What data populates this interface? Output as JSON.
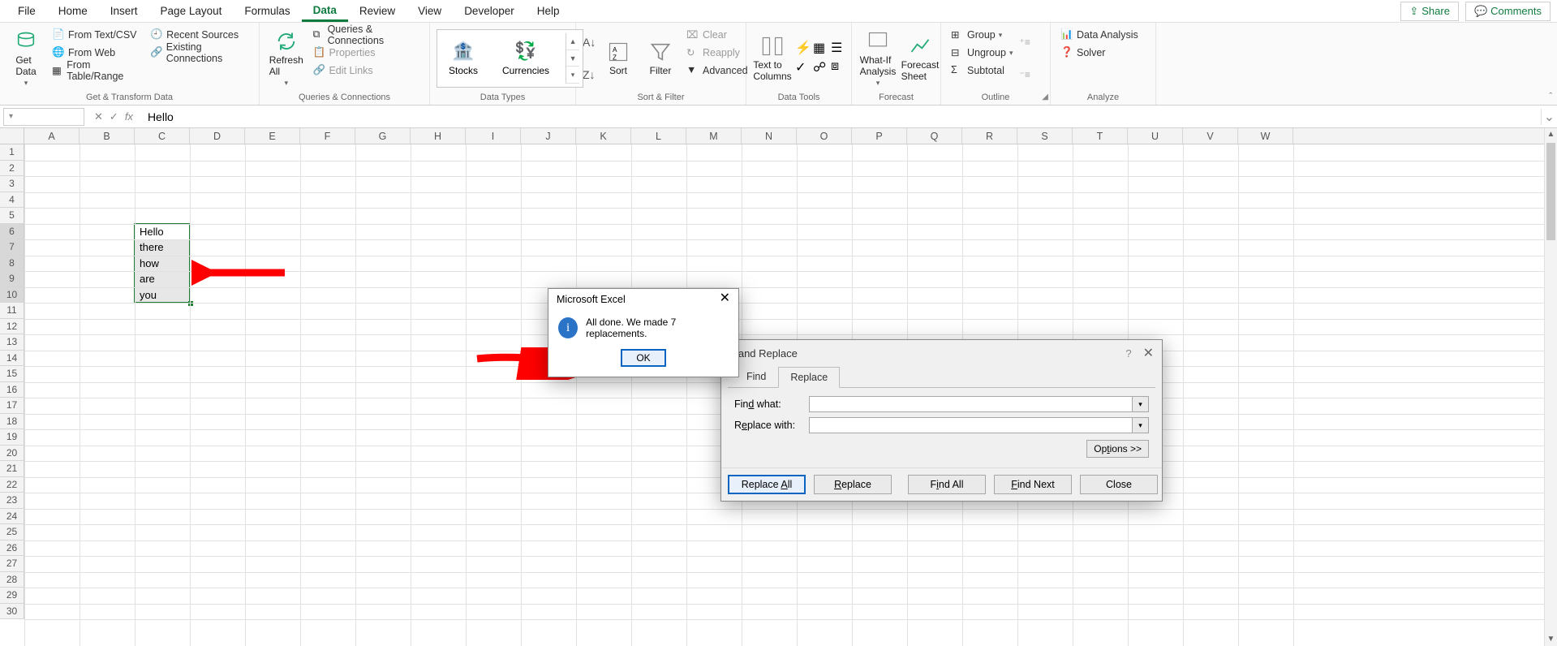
{
  "menu": {
    "file": "File",
    "home": "Home",
    "insert": "Insert",
    "pagelayout": "Page Layout",
    "formulas": "Formulas",
    "data": "Data",
    "review": "Review",
    "view": "View",
    "developer": "Developer",
    "help": "Help"
  },
  "topright": {
    "share": "Share",
    "comments": "Comments"
  },
  "ribbon": {
    "get_data": "Get\nData",
    "from_textcsv": "From Text/CSV",
    "from_web": "From Web",
    "from_table": "From Table/Range",
    "recent_sources": "Recent Sources",
    "existing_conn": "Existing Connections",
    "group_get": "Get & Transform Data",
    "refresh": "Refresh\nAll",
    "queries_conn": "Queries & Connections",
    "properties": "Properties",
    "editlinks": "Edit Links",
    "group_qc": "Queries & Connections",
    "stocks": "Stocks",
    "currencies": "Currencies",
    "group_dt": "Data Types",
    "sort": "Sort",
    "filter": "Filter",
    "clear": "Clear",
    "reapply": "Reapply",
    "advanced": "Advanced",
    "group_sf": "Sort & Filter",
    "text_cols": "Text to\nColumns",
    "group_tools": "Data Tools",
    "whatif": "What-If\nAnalysis",
    "forecast": "Forecast\nSheet",
    "group_fc": "Forecast",
    "group": "Group",
    "ungroup": "Ungroup",
    "subtotal": "Subtotal",
    "group_outline": "Outline",
    "data_analysis": "Data Analysis",
    "solver": "Solver",
    "group_analyze": "Analyze"
  },
  "formula_bar": {
    "name": "",
    "fx_value": "Hello"
  },
  "columns": [
    "A",
    "B",
    "C",
    "D",
    "E",
    "F",
    "G",
    "H",
    "I",
    "J",
    "K",
    "L",
    "M",
    "N",
    "O",
    "P",
    "Q",
    "R",
    "S",
    "T",
    "U",
    "V",
    "W"
  ],
  "cells": {
    "c6": "Hello",
    "c7": "there",
    "c8": "how",
    "c9": "are",
    "c10": "you"
  },
  "msgbox": {
    "title": "Microsoft Excel",
    "text": "All done. We made 7 replacements.",
    "ok": "OK"
  },
  "findrep": {
    "title": "d and Replace",
    "tab_find": "Find",
    "tab_replace": "Replace",
    "findwhat": "Find what:",
    "replacewith": "Replace with:",
    "options": "Options >>",
    "replaceall": "Replace All",
    "replace": "Replace",
    "findall": "Find All",
    "findnext": "Find Next",
    "close": "Close",
    "find_value": "",
    "replace_value": ""
  }
}
